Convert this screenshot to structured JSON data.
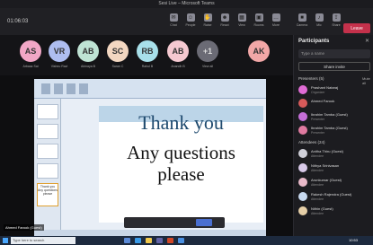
{
  "window": {
    "title": "Sesi Live – Microsoft Teams"
  },
  "toolbar": {
    "timer": "01:06:03",
    "buttons": [
      {
        "label": "Chat",
        "icon": "chat-icon"
      },
      {
        "label": "People",
        "icon": "people-icon"
      },
      {
        "label": "Raise",
        "icon": "hand-icon"
      },
      {
        "label": "React",
        "icon": "react-icon"
      },
      {
        "label": "View",
        "icon": "view-icon"
      },
      {
        "label": "Rooms",
        "icon": "rooms-icon"
      },
      {
        "label": "More",
        "icon": "more-icon"
      }
    ],
    "controls": [
      {
        "label": "Camera",
        "icon": "camera-icon"
      },
      {
        "label": "Mic",
        "icon": "mic-icon"
      },
      {
        "label": "Share",
        "icon": "share-icon"
      }
    ],
    "leave_label": "Leave"
  },
  "participants_strip": [
    {
      "initials": "AS",
      "name": "Arbaaz Sai",
      "color": "#f1a7c6"
    },
    {
      "initials": "VR",
      "name": "Vishnu Ravi",
      "color": "#aebdf0"
    },
    {
      "initials": "AB",
      "name": "Abinaya B",
      "color": "#bfe3d4"
    },
    {
      "initials": "SC",
      "name": "Saran C",
      "color": "#f3d7c1"
    },
    {
      "initials": "RB",
      "name": "Rahul B",
      "color": "#a8e0ea"
    },
    {
      "initials": "AB",
      "name": "Anandh B",
      "color": "#f5c9d1"
    },
    {
      "initials": "+1",
      "name": "View all",
      "color": "#6b6b75"
    }
  ],
  "spotlight": {
    "initials": "AK",
    "color": "#f2a7a7"
  },
  "slide": {
    "line1": "Thank you",
    "line2": "Any questions",
    "line3": "please"
  },
  "thumbnails": [
    "",
    "",
    "",
    "",
    "Thank you Any questions please"
  ],
  "sharer_label": "Ahmed Farook (Guest)",
  "panel": {
    "title": "Participants",
    "search_placeholder": "Type a name",
    "share_label": "Share invite",
    "presenters_header": "Presenters (5)",
    "mute_all": "Mute all",
    "presenters": [
      {
        "name": "Prashant Nataraj",
        "role": "Organizer"
      },
      {
        "name": "Ahmed Farook",
        "role": ""
      },
      {
        "name": "Ibrahim Tamba (Guest)",
        "role": "Presenter"
      },
      {
        "name": "Ibrahim Tamba (Guest)",
        "role": "Presenter"
      }
    ],
    "attendees_header": "Attendees (24)",
    "attendees": [
      {
        "name": "Anitha Thiru (Guest)",
        "role": "Attendee"
      },
      {
        "name": "Nithya Srinivasan",
        "role": "Attendee"
      },
      {
        "name": "Arunkumar (Guest)",
        "role": "Attendee"
      },
      {
        "name": "Rakesh Rajendra (Guest)",
        "role": "Attendee"
      },
      {
        "name": "Nithin (Guest)",
        "role": "Attendee"
      }
    ]
  },
  "taskbar": {
    "search_placeholder": "Type here to search",
    "clock": "10:53"
  }
}
